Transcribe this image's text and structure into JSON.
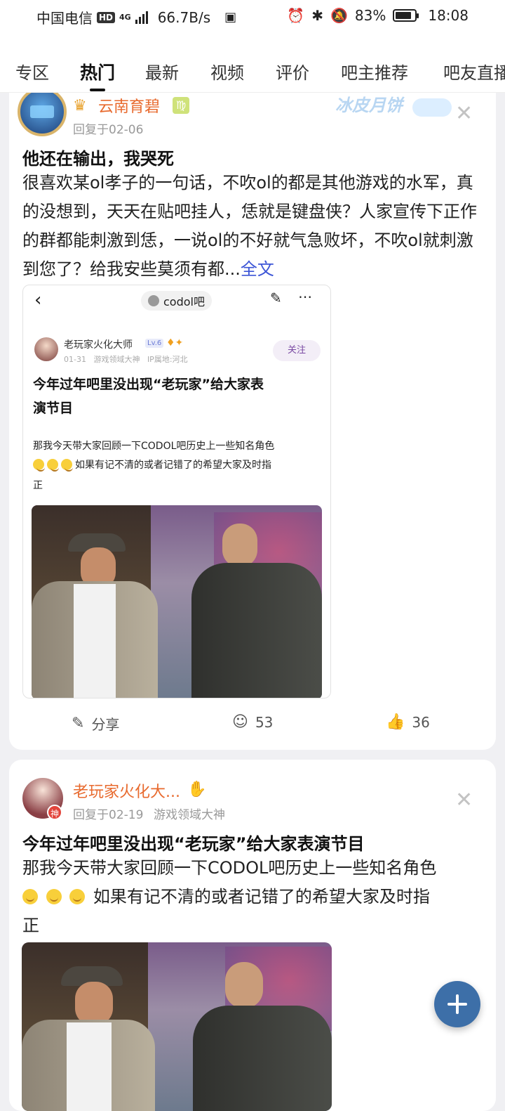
{
  "status_bar": {
    "carrier": "中国电信",
    "hd": "HD",
    "network": "4G",
    "speed": "66.7B/s",
    "battery": "83%",
    "battery_level": 0.83,
    "time": "18:08"
  },
  "tabs": [
    "专区",
    "热门",
    "最新",
    "视频",
    "评价",
    "吧主推荐",
    "吧友直播"
  ],
  "active_tab": "热门",
  "post1": {
    "author": "云南育碧",
    "reply_meta": "回复于02-06",
    "decoration": "冰皮月饼",
    "title": "他还在输出，我哭死",
    "body": "很喜欢某ol孝子的一句话，不吹ol的都是其他游戏的水军，真的没想到，天天在贴吧挂人，恁就是键盘侠？人家宣传下正作的群都能刺激到恁，一说ol的不好就气急败坏，不吹ol就刺激到您了？给我安些莫须有都...",
    "more": "全文",
    "embed": {
      "bar_name": "codol吧",
      "author": "老玩家火化大师",
      "level": "Lv.6",
      "meta": "01-31   游戏领域大神   IP属地:河北",
      "follow": "关注",
      "title_line1": "今年过年吧里没出现“老玩家”给大家表",
      "title_line2": "演节目",
      "body_line1": "那我今天带大家回顾一下CODOL吧历史上一些知名角色",
      "body_line2": "如果有记不清的或者记错了的希望大家及时指",
      "body_line3": "正"
    },
    "actions": {
      "share": "分享",
      "comments": "53",
      "likes": "36"
    }
  },
  "post2": {
    "author": "老玩家火化大...",
    "avatar_badge": "神",
    "reply_meta": "回复于02-19",
    "title_badge": "游戏领域大神",
    "title": "今年过年吧里没出现“老玩家”给大家表演节目",
    "body_line1": "那我今天带大家回顾一下CODOL吧历史上一些知名角色",
    "body_line2": "如果有记不清的或者记错了的希望大家及时指",
    "body_line3": "正"
  }
}
